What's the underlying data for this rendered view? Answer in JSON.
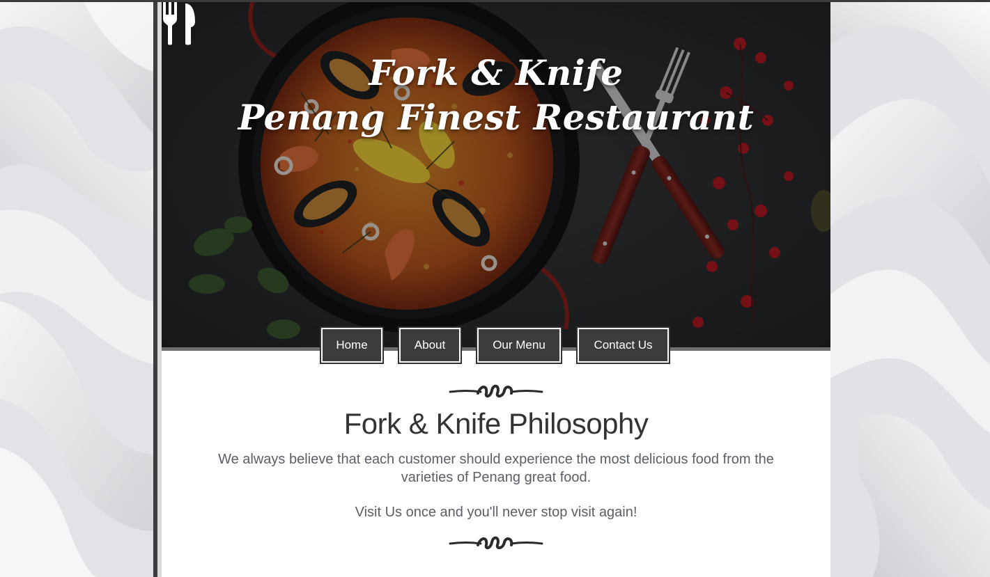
{
  "header": {
    "title_line1": "Fork & Knife",
    "title_line2": "Penang Finest Restaurant",
    "logo_icon": "cutlery-icon"
  },
  "nav": {
    "items": [
      {
        "label": "Home"
      },
      {
        "label": "About"
      },
      {
        "label": "Our Menu"
      },
      {
        "label": "Contact Us"
      }
    ]
  },
  "main": {
    "divider_icon": "ornament-divider-icon",
    "heading": "Fork & Knife Philosophy",
    "paragraph": "We always believe that each customer should experience the most delicious food from the varieties of Penang great food.",
    "tagline": "Visit Us once and you'll never stop visit again!"
  },
  "colors": {
    "nav_button_bg": "#3c3c3c",
    "nav_button_border": "#ffffff",
    "heading_text": "#333333",
    "body_text": "#5a5f66",
    "page_background": "#e9e9ec"
  }
}
